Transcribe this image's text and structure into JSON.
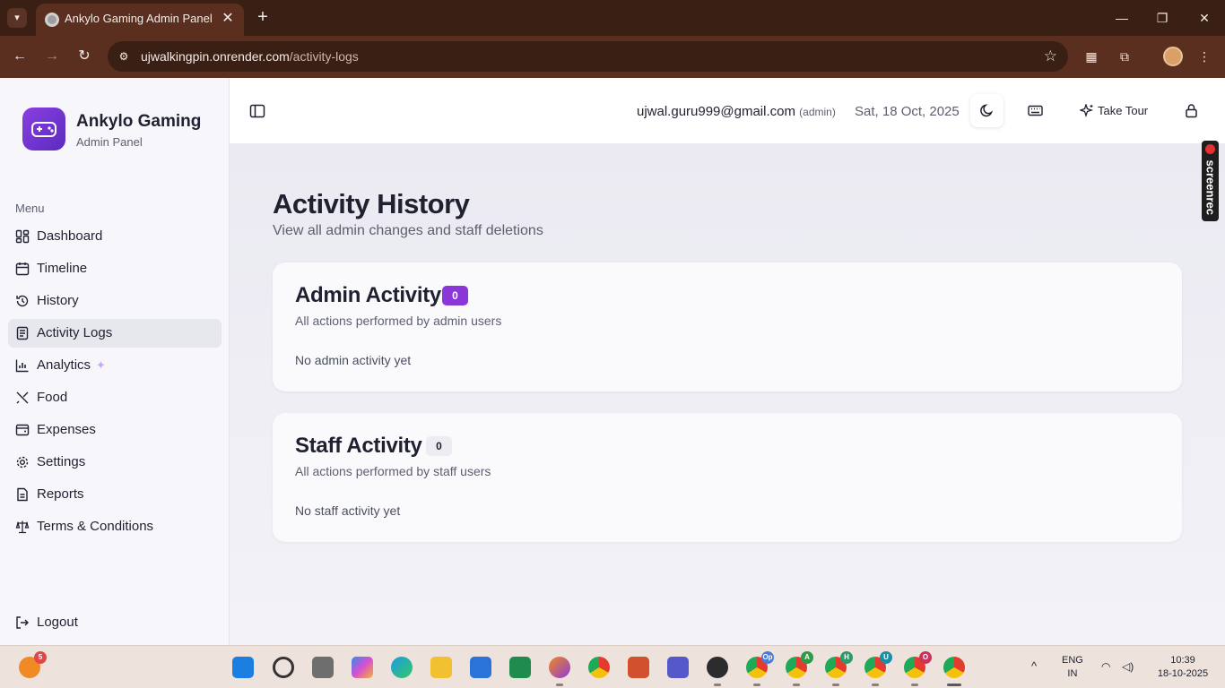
{
  "browser": {
    "tab_title": "Ankylo Gaming Admin Panel",
    "url_host": "ujwalkingpin.onrender.com",
    "url_path": "/activity-logs"
  },
  "sidebar": {
    "brand_name": "Ankylo Gaming",
    "brand_sub": "Admin Panel",
    "menu_label": "Menu",
    "items": [
      {
        "label": "Dashboard",
        "icon": "dashboard-icon"
      },
      {
        "label": "Timeline",
        "icon": "calendar-icon"
      },
      {
        "label": "History",
        "icon": "history-icon"
      },
      {
        "label": "Activity Logs",
        "icon": "activity-logs-icon",
        "active": true
      },
      {
        "label": "Analytics",
        "icon": "chart-icon",
        "badge": "sparkle-icon"
      },
      {
        "label": "Food",
        "icon": "utensils-icon"
      },
      {
        "label": "Expenses",
        "icon": "receipt-icon"
      },
      {
        "label": "Settings",
        "icon": "gear-icon"
      },
      {
        "label": "Reports",
        "icon": "document-icon"
      },
      {
        "label": "Terms & Conditions",
        "icon": "scale-icon"
      }
    ],
    "logout_label": "Logout"
  },
  "header": {
    "user_email": "ujwal.guru999@gmail.com",
    "user_role": "(admin)",
    "date": "Sat, 18 Oct, 2025",
    "tour_label": "Take Tour"
  },
  "page": {
    "title": "Activity History",
    "subtitle": "View all admin changes and staff deletions",
    "admin_card": {
      "title": "Admin Activity",
      "count": "0",
      "subtitle": "All actions performed by admin users",
      "empty": "No admin activity yet"
    },
    "staff_card": {
      "title": "Staff Activity",
      "count": "0",
      "subtitle": "All actions performed by staff users",
      "empty": "No staff activity yet"
    }
  },
  "screenrec_label": "screenrec",
  "taskbar": {
    "notification_count": "5",
    "language": "ENG",
    "region": "IN",
    "time": "10:39",
    "date": "18-10-2025",
    "badges": {
      "op": "Op",
      "a": "A",
      "h": "H",
      "u": "U",
      "o": "O"
    }
  },
  "colors": {
    "accent": "#8a36d8",
    "browser_frame": "#5b2f20",
    "text_primary": "#1f2130"
  }
}
